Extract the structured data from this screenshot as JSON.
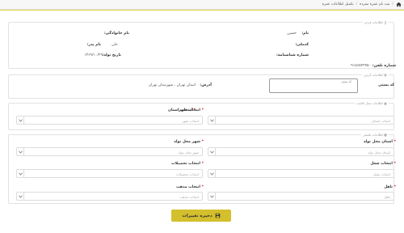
{
  "breadcrumb": {
    "items": [
      "ثبت نام عمره مفرده",
      "تکمیل اطلاعات عمره"
    ],
    "separator": "/"
  },
  "sections": {
    "personal": "اطلاعات فردی",
    "address": "اطلاعات آدرس",
    "residence": "اطلاعات محل اقامت",
    "extra": "اطلاعات تکمیلی"
  },
  "personal": {
    "first_name_label": "نام:",
    "first_name_value": "حسین",
    "last_name_label": "نام خانوادگی:",
    "last_name_value": "",
    "national_code_label": "کدملی:",
    "national_code_value": "",
    "father_name_label": "نام پدر:",
    "father_name_value": "علی",
    "id_number_label": "شماره شناسنامه:",
    "id_number_value": "",
    "birth_date_label": "تاریخ تولد:",
    "birth_date_value": "۱۳۶۹/۱۰/۲۹",
    "phone_label": "شماره تلفن:",
    "phone_value": "۰۹۱۵۶۵۴۳۷۵۰"
  },
  "address": {
    "postal_label": "کد پستی",
    "postal_placeholder": "کد پستی",
    "postal_value": "",
    "address_label": "آدرس:",
    "address_value": "استان تهران ، شهرستان تهران"
  },
  "residence": {
    "province_label": "انتخاب استان",
    "province_placeholder": "انتخاب استان",
    "city_label": "انتخاب شهر",
    "city_placeholder": "انتخاب شهر"
  },
  "extra": {
    "birth_province_label": "استان محل تولد",
    "birth_province_placeholder": "استان محل تولد",
    "birth_city_label": "شهر محل تولد",
    "birth_city_placeholder": "شهر محل تولد",
    "job_label": "انتخاب شغل",
    "job_placeholder": "انتخاب شغل",
    "education_label": "انتخاب تحصیلات",
    "education_placeholder": "انتخاب تحصیلات",
    "marital_label": "تاهل",
    "marital_placeholder": "تاهل",
    "religion_label": "انتخاب مذهب",
    "religion_placeholder": "انتخاب مذهب"
  },
  "save_button": "ذخیره تغییرات",
  "colors": {
    "accent": "#d4bf2c",
    "required": "#dd2222"
  }
}
